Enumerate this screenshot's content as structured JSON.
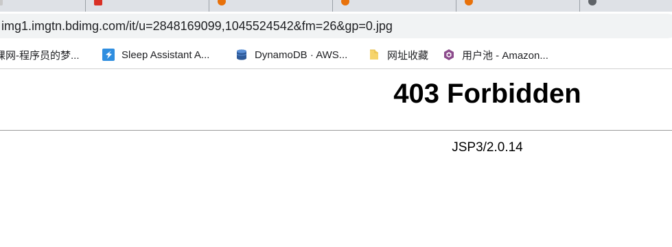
{
  "browser": {
    "address_bar": {
      "url": "img1.imgtn.bdimg.com/it/u=2848169099,1045524542&fm=26&gp=0.jpg"
    },
    "bookmarks": [
      {
        "label": "慕课网-程序员的梦...",
        "icon": "imooc-icon"
      },
      {
        "label": "Sleep Assistant A...",
        "icon": "sleep-assistant-icon"
      },
      {
        "label": "DynamoDB · AWS...",
        "icon": "dynamodb-icon"
      },
      {
        "label": "网址收藏",
        "icon": "folder-icon"
      },
      {
        "label": "用户池 - Amazon...",
        "icon": "cognito-icon"
      }
    ]
  },
  "page": {
    "title": "403 Forbidden",
    "server": "JSP3/2.0.14"
  },
  "colors": {
    "tabstrip": "#dee1e6",
    "omnibox": "#f1f3f4",
    "rule": "#9a9a9a",
    "text": "#000000"
  }
}
